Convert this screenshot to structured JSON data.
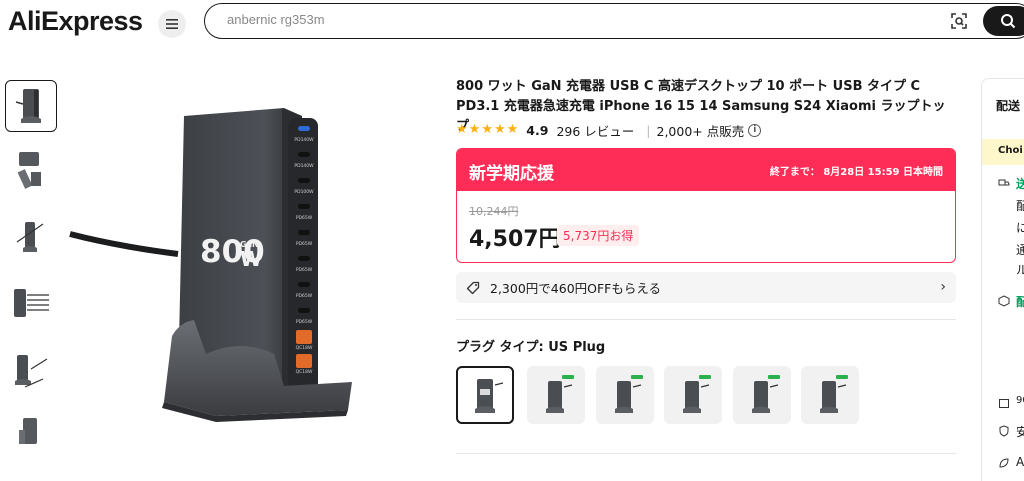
{
  "header": {
    "logo_text": "AliExpress",
    "search_placeholder": "anbernic rg353m",
    "icons": [
      "menu-icon",
      "camera-search-icon",
      "search-icon"
    ]
  },
  "gallery": {
    "thumbnail_count": 6,
    "selected_index": 0,
    "main_image_labels": {
      "wattage": "800",
      "wattage_unit_top": "GaN",
      "wattage_unit": "W",
      "ports": [
        "PD140W",
        "PD140W",
        "PD100W",
        "PD65W",
        "PD65W",
        "PD65W",
        "PD65W",
        "PD65W",
        "QC18W",
        "QC18W"
      ]
    }
  },
  "product": {
    "title": "800 ワット GaN 充電器 USB C 高速デスクトップ 10 ポート USB タイプ C PD3.1 充電器急速充電 iPhone 16 15 14 Samsung S24 Xiaomi ラップトップ",
    "rating": "4.9",
    "reviews": "296 レビュー",
    "sold": "2,000+ 点販売",
    "star_count": 5
  },
  "promo": {
    "title": "新学期応援",
    "countdown_label": "終了まで：",
    "countdown_value": "8月28日 15:59 日本時間",
    "original_price": "10,244円",
    "price": "4,507円",
    "save_text": "5,737円お得",
    "accent_color": "#fd2d57"
  },
  "coupon": {
    "text": "2,300円で460円OFFもらえる"
  },
  "variants": {
    "label": "プラグ タイプ: US Plug",
    "count": 6,
    "selected_index": 0
  },
  "side_panel": {
    "title": "配送",
    "choice_label": "Choi",
    "lines": [
      "送",
      "配",
      "に",
      "通",
      "ル",
      "配",
      "90",
      "安",
      "A"
    ]
  }
}
